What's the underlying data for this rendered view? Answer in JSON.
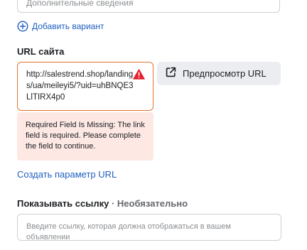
{
  "top_field": {
    "placeholder": "Дополнительные сведения"
  },
  "add_variant": {
    "label": "Добавить вариант",
    "icon": "plus-circle-icon"
  },
  "website_url": {
    "label": "URL сайта",
    "value": "http://salestrend.shop/landings/ua/meileyi5/?uid=uhBNQE3LlTIRX4p0",
    "status_icon": "warning-triangle-icon",
    "error": "Required Field Is Missing: The link field is required. Please complete the field to continue."
  },
  "preview_button": {
    "label": "Предпросмотр URL",
    "icon": "external-link-icon"
  },
  "url_parameter_link": {
    "label": "Создать параметр URL"
  },
  "display_link": {
    "label": "Показывать ссылку",
    "optional": "· Необязательно",
    "placeholder": "Введите ссылку, которая должна отображаться в вашем объявлении"
  },
  "colors": {
    "link_blue": "#1f5fbf",
    "error_border": "#e5732d",
    "error_bg": "#fde8e4",
    "warning_red": "#e4202e",
    "button_bg": "#ebedf0"
  }
}
